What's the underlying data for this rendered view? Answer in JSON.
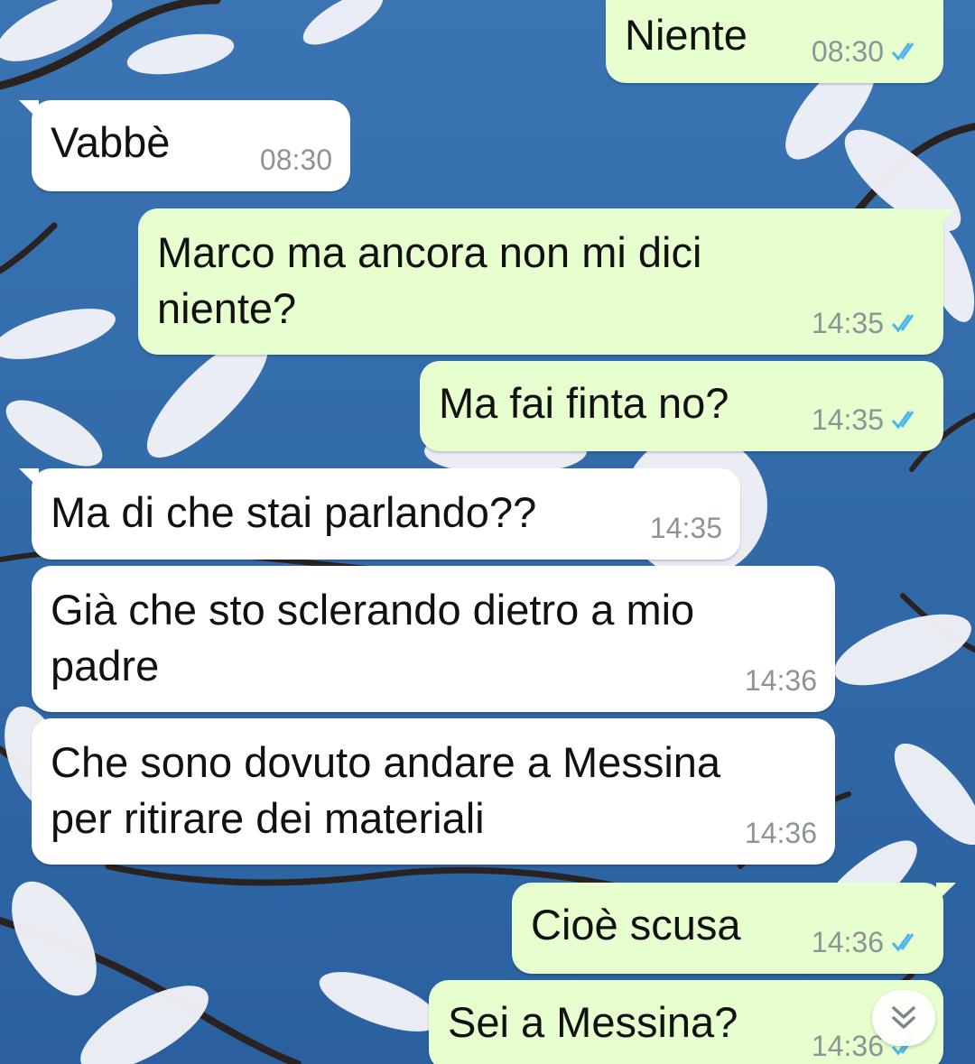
{
  "chat": {
    "messages": [
      {
        "direction": "out",
        "text": "Niente",
        "time": "08:30",
        "status": "read"
      },
      {
        "direction": "in",
        "text": "Vabbè",
        "time": "08:30"
      },
      {
        "direction": "out",
        "text": "Marco ma ancora non mi dici\nniente?",
        "time": "14:35",
        "status": "read"
      },
      {
        "direction": "out",
        "text": "Ma fai finta no?",
        "time": "14:35",
        "status": "read"
      },
      {
        "direction": "in",
        "text": "Ma di che stai parlando??",
        "time": "14:35"
      },
      {
        "direction": "in",
        "text": "Già che sto sclerando dietro a mio\npadre",
        "time": "14:36"
      },
      {
        "direction": "in",
        "text": "Che sono dovuto andare a  Messina\nper ritirare dei materiali",
        "time": "14:36"
      },
      {
        "direction": "out",
        "text": "Cioè scusa",
        "time": "14:36",
        "status": "read"
      },
      {
        "direction": "out",
        "text": "Sei a Messina?",
        "time": "14:36",
        "status": "read"
      }
    ]
  },
  "scroll_button": {
    "icon": "double-chevron-down-icon"
  },
  "colors": {
    "outgoing_bubble": "#e7fecf",
    "incoming_bubble": "#ffffff",
    "read_ticks": "#4fb6ec",
    "timestamp": "#8c9497",
    "wallpaper_sky": "#2f69a8"
  }
}
